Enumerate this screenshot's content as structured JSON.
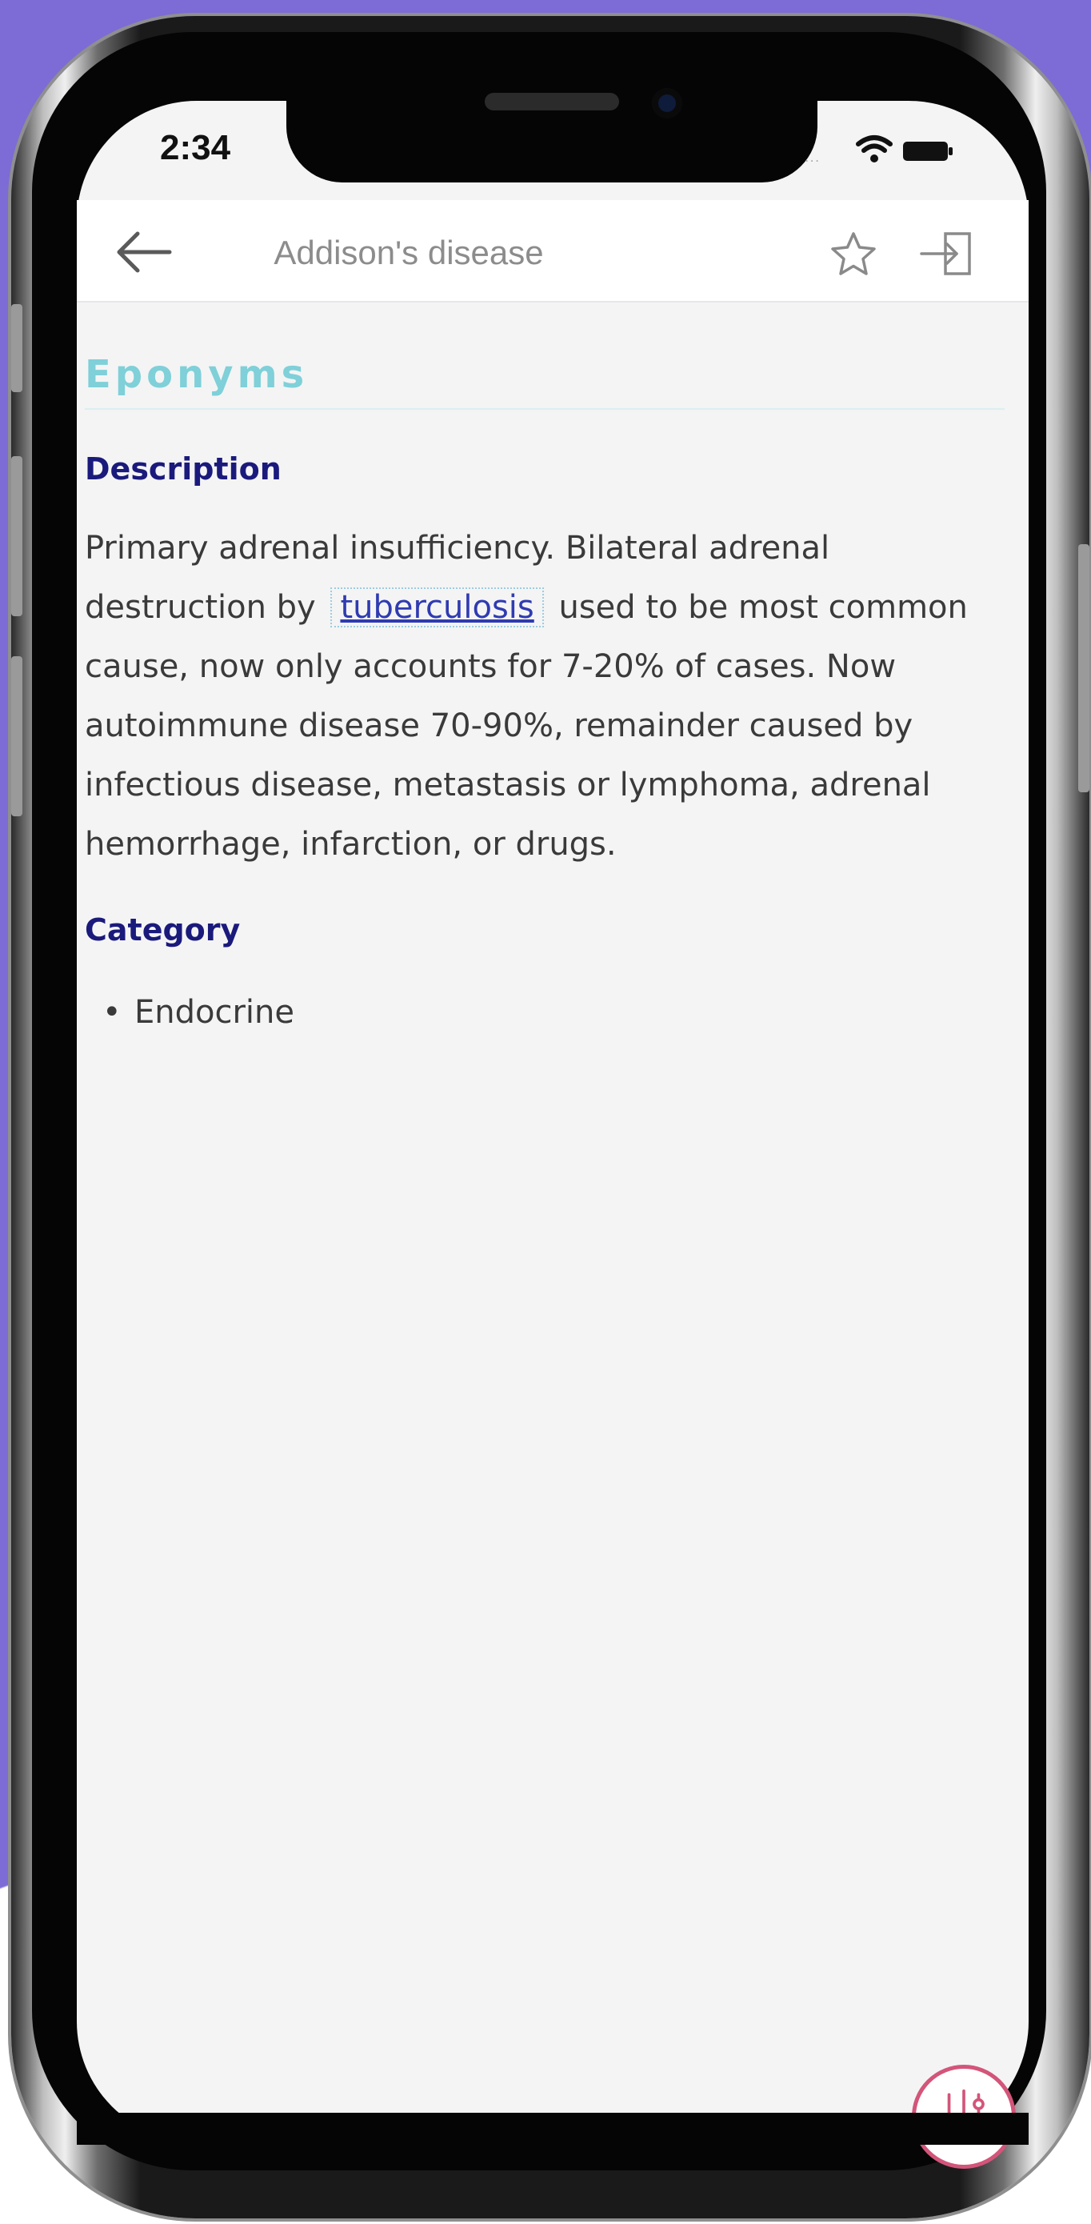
{
  "status_bar": {
    "time": "2:34",
    "signal_text": "....",
    "wifi_icon": "wifi-icon",
    "battery_icon": "battery-icon"
  },
  "navbar": {
    "back_icon": "back-arrow-icon",
    "title": "Addison's disease",
    "favorite_icon": "star-icon",
    "export_icon": "export-icon"
  },
  "content": {
    "section_heading": "Eponyms",
    "description_label": "Description",
    "description": {
      "before_link": "Primary adrenal insufficiency. Bilateral adrenal destruction by",
      "link_text": "tuberculosis",
      "after_link": "used to be most common cause, now only accounts for 7-20% of cases. Now autoimmune disease 70-90%, remainder caused by infectious disease, metastasis or lymphoma, adrenal hemorrhage, infarction, or drugs."
    },
    "category_label": "Category",
    "categories": [
      "Endocrine"
    ]
  },
  "fab": {
    "icon": "sliders-icon"
  },
  "colors": {
    "background_purple": "#7d6bd6",
    "heading_teal": "#7fd0d8",
    "label_navy": "#1a1a7c",
    "link_blue": "#2f3bb0",
    "fab_pink": "#d3557a"
  }
}
